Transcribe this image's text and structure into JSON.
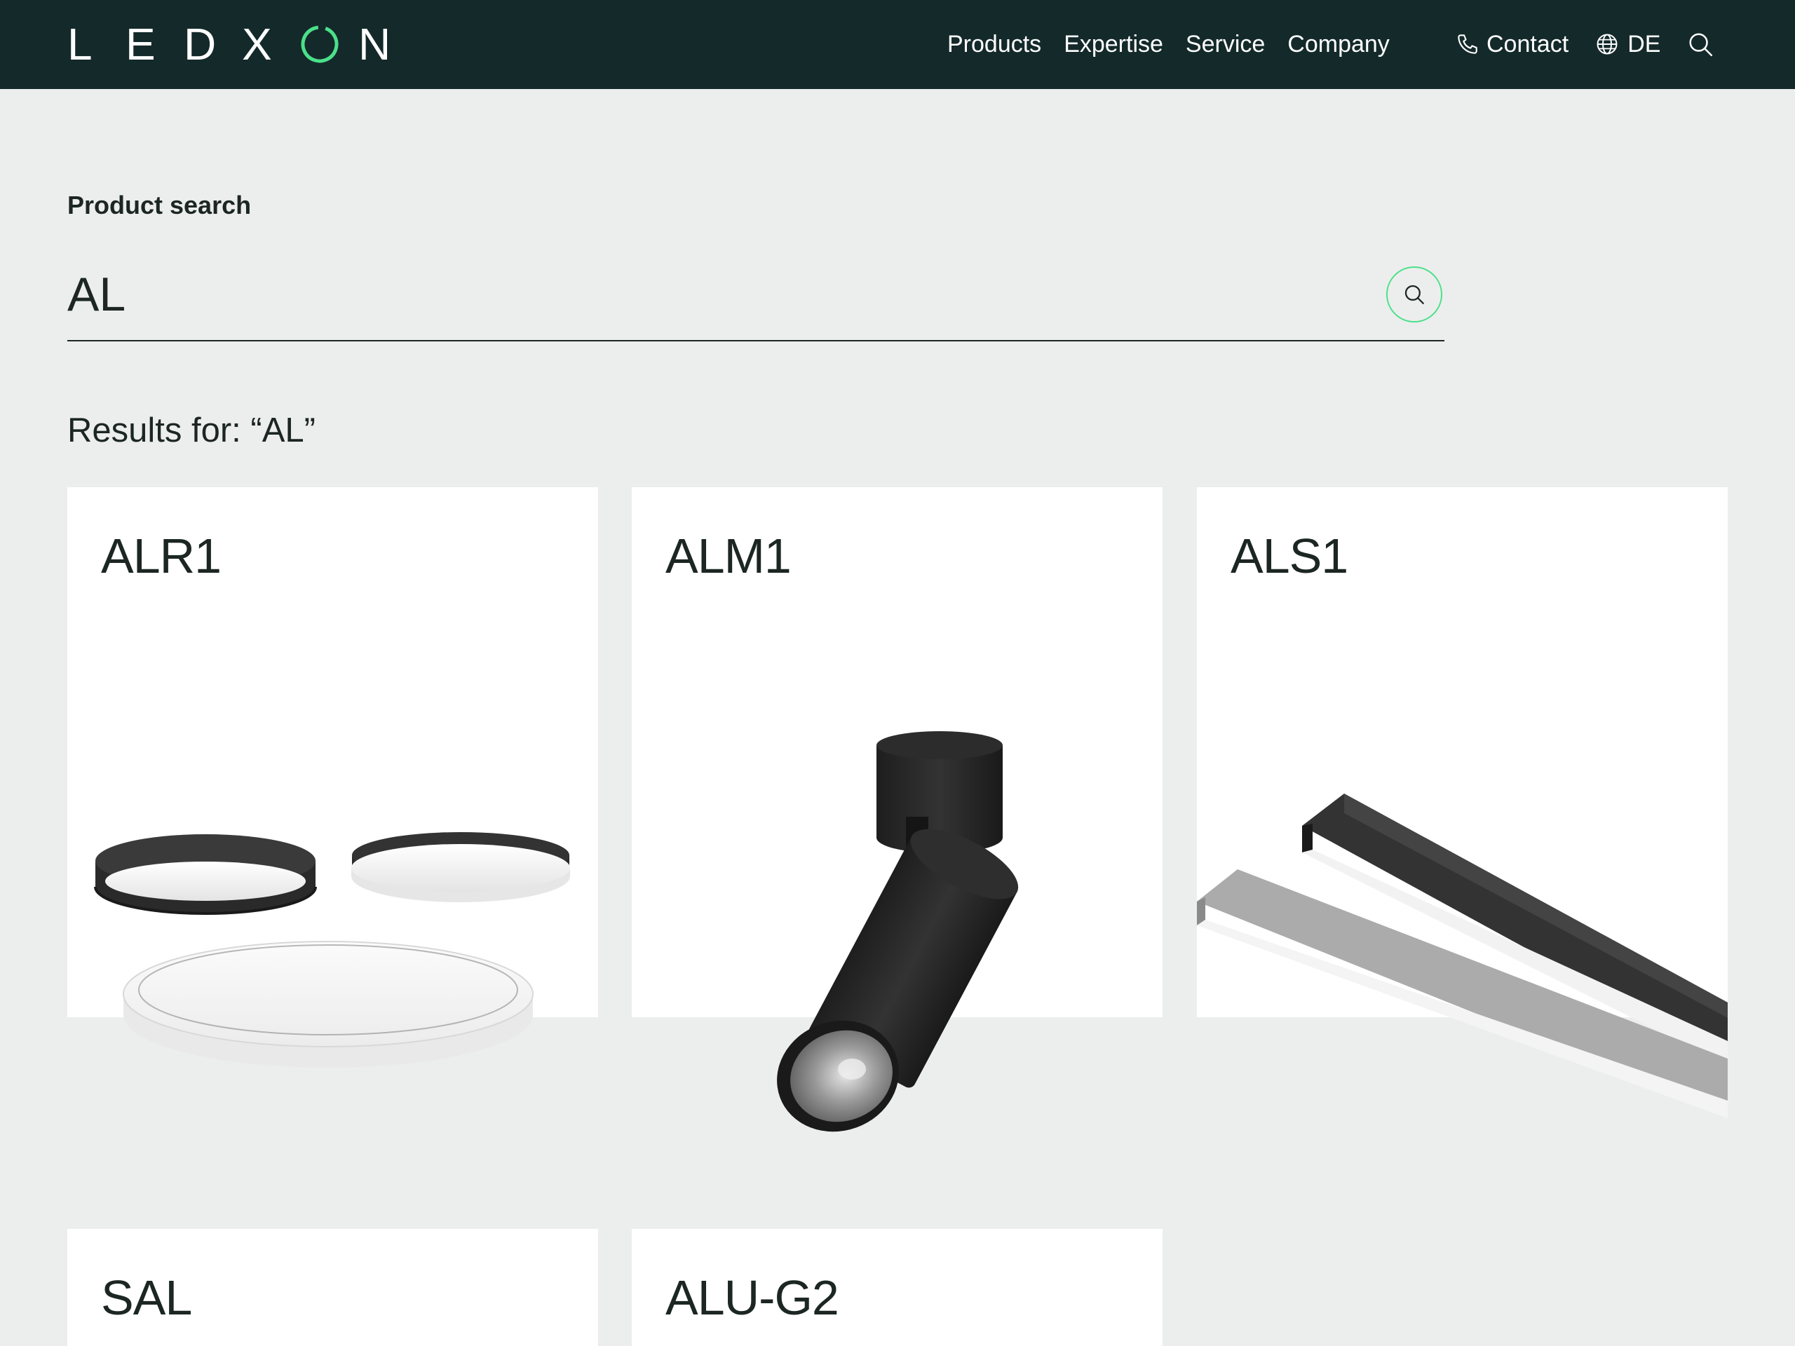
{
  "header": {
    "logo_letters": [
      "L",
      "E",
      "D",
      "X",
      "O",
      "N"
    ],
    "nav": [
      "Products",
      "Expertise",
      "Service",
      "Company"
    ],
    "contact_label": "Contact",
    "language_label": "DE"
  },
  "search": {
    "label": "Product search",
    "value": "AL",
    "results_heading": "Results for: “AL”"
  },
  "results": [
    {
      "name": "ALR1",
      "image": "round-ceiling-luminaires"
    },
    {
      "name": "ALM1",
      "image": "surface-spotlight"
    },
    {
      "name": "ALS1",
      "image": "linear-profile-luminaires"
    },
    {
      "name": "SAL",
      "image": ""
    },
    {
      "name": "ALU-G2",
      "image": ""
    }
  ],
  "colors": {
    "header_bg": "#14292a",
    "page_bg": "#eceeed",
    "accent": "#4be08a",
    "text": "#1c2623"
  },
  "icons": [
    "phone-icon",
    "globe-icon",
    "search-icon"
  ]
}
